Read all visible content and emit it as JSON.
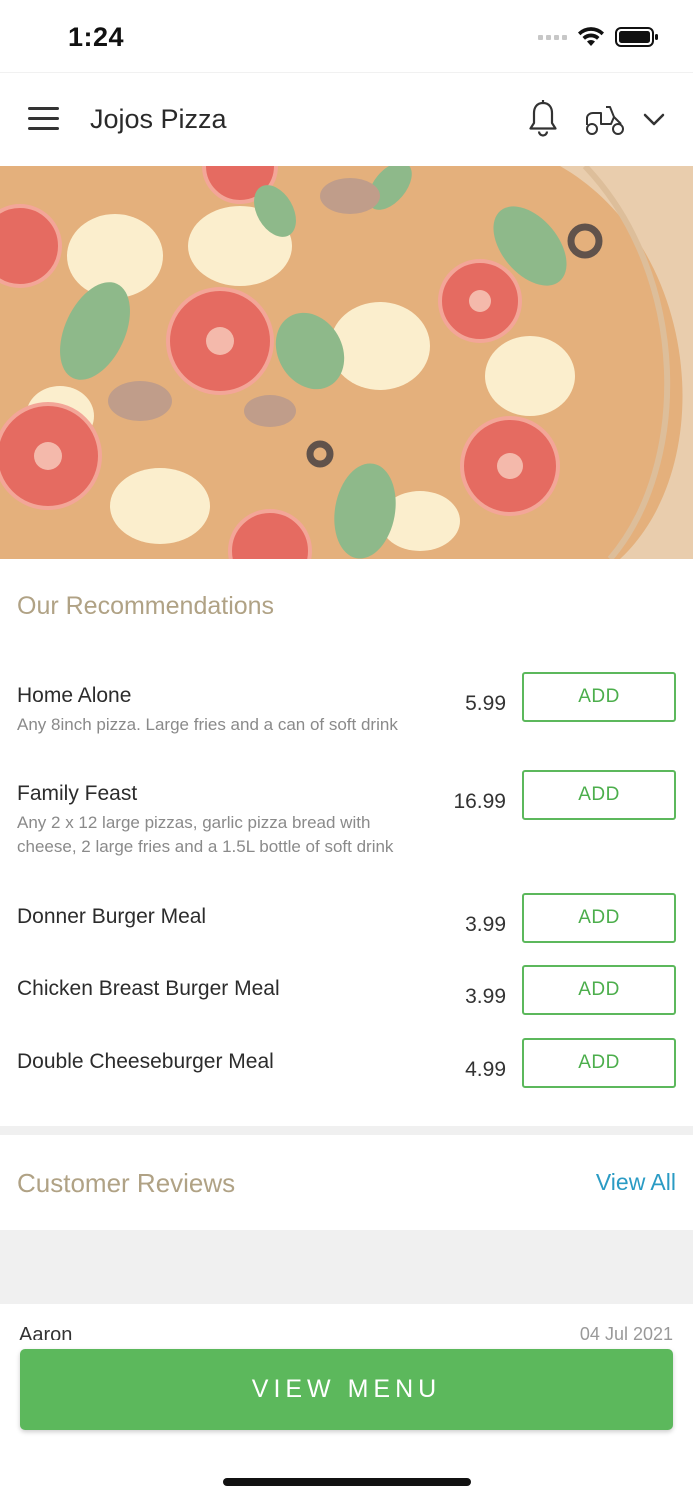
{
  "status_bar": {
    "time": "1:24"
  },
  "header": {
    "store_name": "Jojos Pizza",
    "icons": [
      "menu-icon",
      "bell-icon",
      "scooter-icon",
      "chevron-down-icon"
    ]
  },
  "recommendations": {
    "title": "Our Recommendations",
    "add_label": "ADD",
    "items": [
      {
        "name": "Home Alone",
        "description": "Any 8inch pizza. Large fries and a can of soft drink",
        "price": "5.99"
      },
      {
        "name": "Family Feast",
        "description": "Any 2 x 12 large pizzas, garlic pizza bread with cheese, 2 large fries and a 1.5L bottle of soft drink",
        "price": "16.99"
      },
      {
        "name": "Donner Burger Meal",
        "description": "",
        "price": "3.99"
      },
      {
        "name": "Chicken Breast Burger Meal",
        "description": "",
        "price": "3.99"
      },
      {
        "name": "Double Cheeseburger Meal",
        "description": "",
        "price": "4.99"
      }
    ]
  },
  "reviews": {
    "title": "Customer Reviews",
    "view_all": "View All",
    "first_review": {
      "author": "Aaron",
      "date": "04 Jul 2021"
    }
  },
  "footer": {
    "view_menu": "VIEW MENU"
  },
  "colors": {
    "accent_green": "#5cb85c",
    "title_tan": "#b0a285",
    "link_blue": "#2a9bc4"
  }
}
